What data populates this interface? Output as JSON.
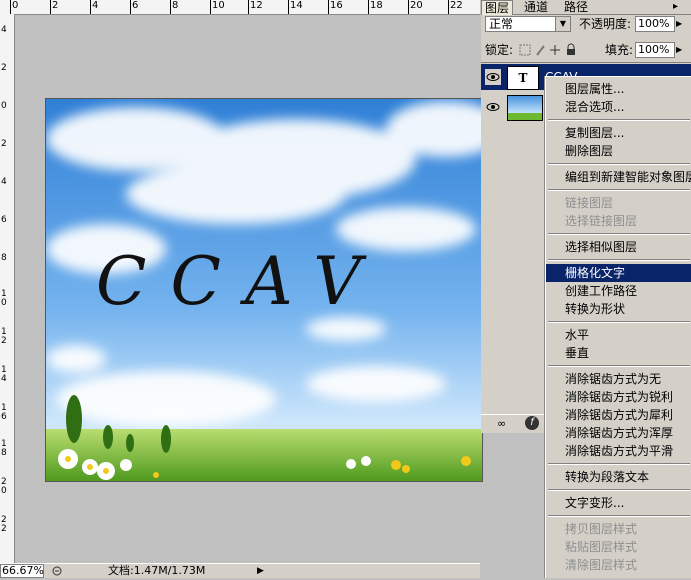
{
  "ruler_top": [
    "0",
    "2",
    "4",
    "6",
    "8",
    "10",
    "12",
    "14",
    "16",
    "18",
    "20",
    "22"
  ],
  "ruler_left": [
    "4",
    "2",
    "0",
    "2",
    "4",
    "6",
    "8",
    "1\n0",
    "1\n2",
    "1\n4",
    "1\n6",
    "1\n8",
    "2\n0",
    "2\n2"
  ],
  "canvas": {
    "text": "CCAV"
  },
  "status": {
    "zoom": "66.67%",
    "doc": "文档:1.47M/1.73M"
  },
  "panel": {
    "tabs": [
      "图层",
      "通道",
      "路径"
    ],
    "blend_mode": "正常",
    "opacity_label": "不透明度:",
    "opacity_value": "100%",
    "lock_label": "锁定:",
    "fill_label": "填充:",
    "fill_value": "100%",
    "text_layer_thumb": "T",
    "text_layer_name": "CCAV"
  },
  "menu": [
    {
      "label": "图层属性...",
      "state": "normal"
    },
    {
      "label": "混合选项...",
      "state": "normal"
    },
    {
      "sep": true
    },
    {
      "label": "复制图层...",
      "state": "normal"
    },
    {
      "label": "删除图层",
      "state": "normal"
    },
    {
      "sep": true
    },
    {
      "label": "编组到新建智能对象图层",
      "state": "normal"
    },
    {
      "sep": true
    },
    {
      "label": "链接图层",
      "state": "disabled"
    },
    {
      "label": "选择链接图层",
      "state": "disabled"
    },
    {
      "sep": true
    },
    {
      "label": "选择相似图层",
      "state": "normal"
    },
    {
      "sep": true
    },
    {
      "label": "栅格化文字",
      "state": "selected"
    },
    {
      "label": "创建工作路径",
      "state": "normal"
    },
    {
      "label": "转换为形状",
      "state": "normal"
    },
    {
      "sep": true
    },
    {
      "label": "水平",
      "state": "normal"
    },
    {
      "label": "垂直",
      "state": "normal"
    },
    {
      "sep": true
    },
    {
      "label": "消除锯齿方式为无",
      "state": "normal"
    },
    {
      "label": "消除锯齿方式为锐利",
      "state": "normal"
    },
    {
      "label": "消除锯齿方式为犀利",
      "state": "normal"
    },
    {
      "label": "消除锯齿方式为浑厚",
      "state": "normal"
    },
    {
      "label": "消除锯齿方式为平滑",
      "state": "normal"
    },
    {
      "sep": true
    },
    {
      "label": "转换为段落文本",
      "state": "normal"
    },
    {
      "sep": true
    },
    {
      "label": "文字变形...",
      "state": "normal"
    },
    {
      "sep": true
    },
    {
      "label": "拷贝图层样式",
      "state": "disabled"
    },
    {
      "label": "粘贴图层样式",
      "state": "disabled"
    },
    {
      "label": "清除图层样式",
      "state": "disabled"
    }
  ],
  "colors": {
    "selection": "#0a246a",
    "panel_bg": "#d4d0c8",
    "workspace": "#c0c0c0",
    "sky": "#4a94e0",
    "grass": "#6fb832"
  }
}
